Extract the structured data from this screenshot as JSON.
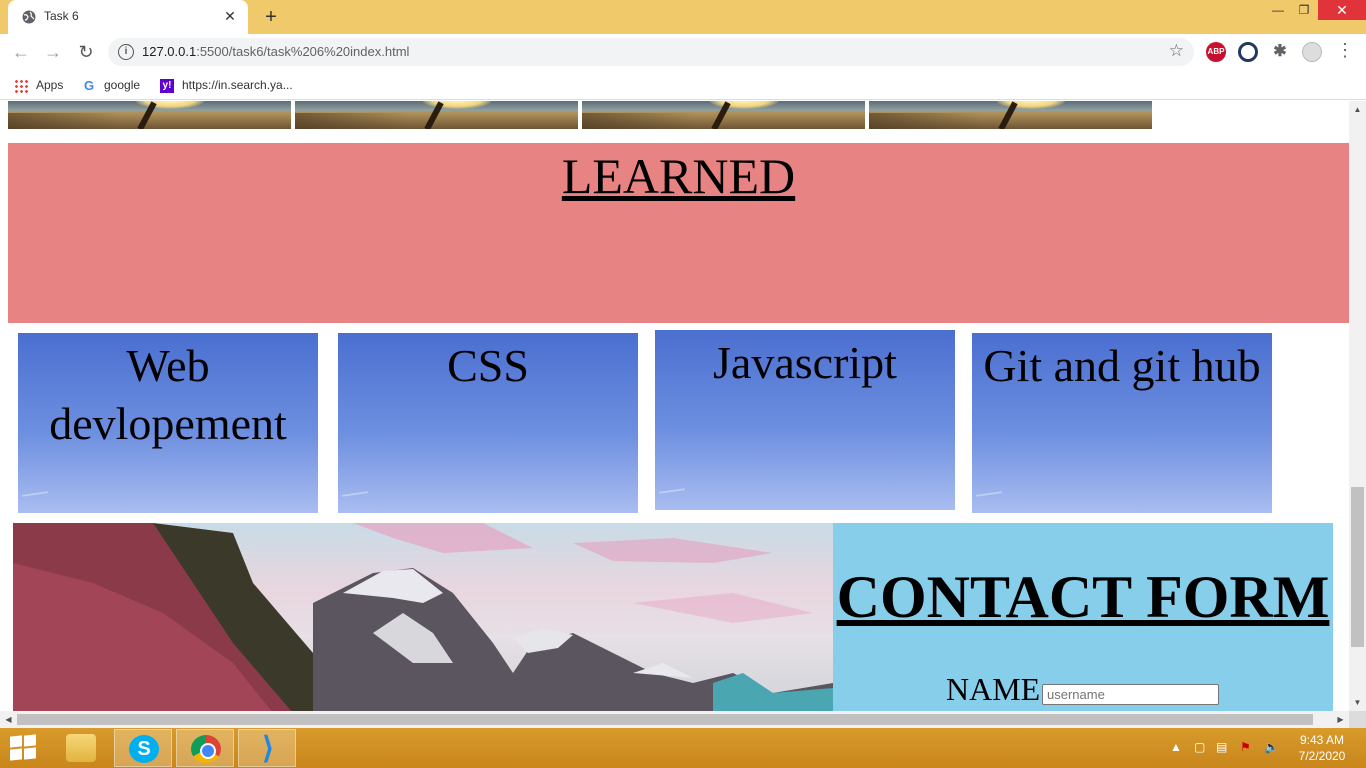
{
  "browser": {
    "tab_title": "Task 6",
    "url_host": "127.0.0.1",
    "url_path": ":5500/task6/task%206%20index.html",
    "bookmarks": [
      {
        "label": "Apps"
      },
      {
        "label": "google"
      },
      {
        "label": "https://in.search.ya..."
      }
    ],
    "extensions": [
      "abp-icon",
      "lens-icon",
      "puzzle-icon",
      "profile-avatar"
    ]
  },
  "page": {
    "learned_title": "LEARNED",
    "skills": [
      {
        "label": "Web devlopement"
      },
      {
        "label": "CSS"
      },
      {
        "label": "Javascript"
      },
      {
        "label": "Git and git hub"
      }
    ],
    "contact": {
      "title": "CONTACT FORM",
      "name_label": "NAME",
      "name_placeholder": "username"
    }
  },
  "taskbar": {
    "apps": [
      "file-explorer-icon",
      "skype-icon",
      "chrome-icon",
      "vscode-icon"
    ],
    "time": "9:43 AM",
    "date": "7/2/2020"
  },
  "colors": {
    "titlebar": "#f0c96a",
    "learned_band": "#e88383",
    "skill_card": "#5b7ed6",
    "contact_panel": "#87ceeb",
    "taskbar": "#d08f22"
  }
}
